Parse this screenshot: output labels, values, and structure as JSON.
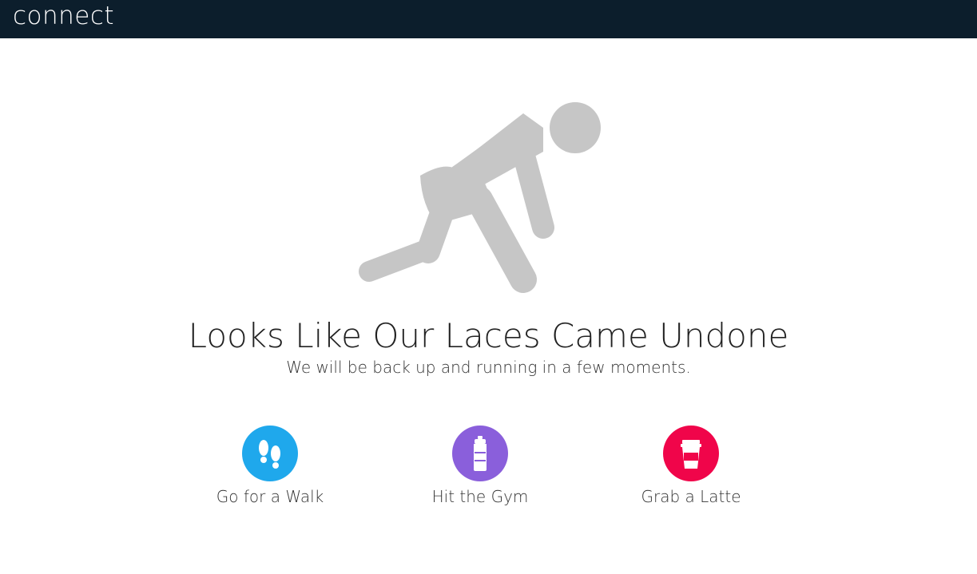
{
  "header": {
    "logo_text": "connect",
    "background_color": "#0c1e2c"
  },
  "illustration": {
    "icon": "tying-shoelace-person-icon",
    "color": "#c6c6c6"
  },
  "message": {
    "headline": "Looks Like Our Laces Came Undone",
    "subline": "We will be back up and running in a few moments."
  },
  "actions": [
    {
      "label": "Go for a Walk",
      "icon": "footprints-icon",
      "color": "#1fa8ec"
    },
    {
      "label": "Hit the Gym",
      "icon": "water-bottle-icon",
      "color": "#8a5fdb"
    },
    {
      "label": "Grab a Latte",
      "icon": "coffee-cup-icon",
      "color": "#f0054a"
    }
  ]
}
